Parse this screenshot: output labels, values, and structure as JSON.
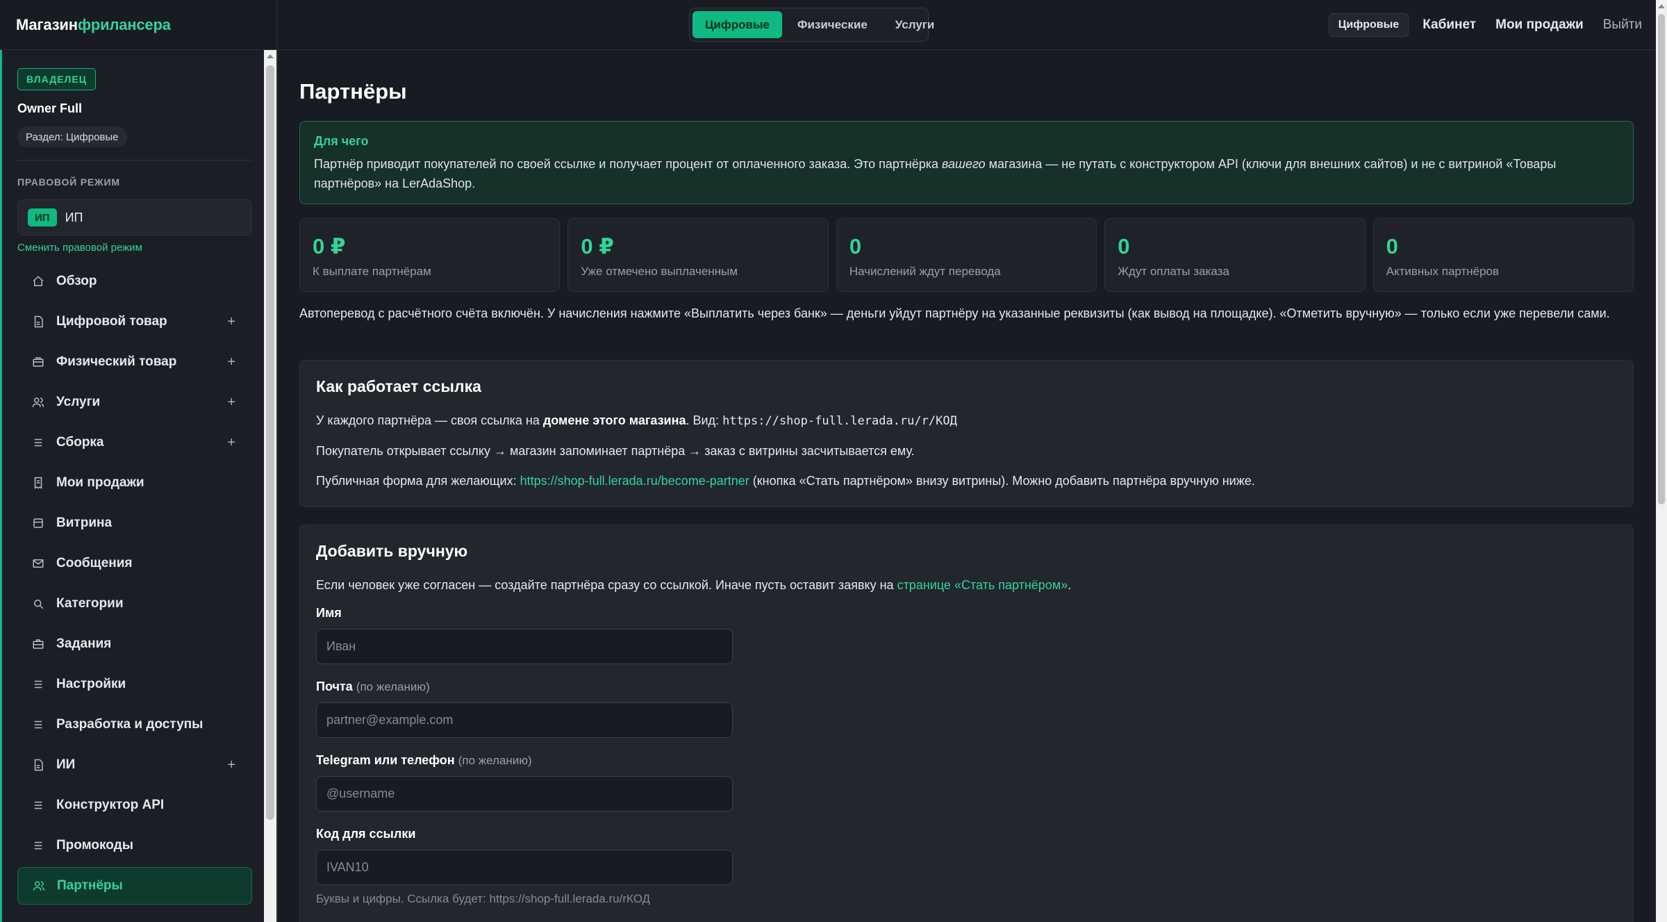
{
  "brand": {
    "part1": "Магазин",
    "part2": "фрилансера"
  },
  "header": {
    "segments": [
      {
        "label": "Цифровые",
        "active": true
      },
      {
        "label": "Физические",
        "active": false
      },
      {
        "label": "Услуги",
        "active": false
      }
    ],
    "mode_pill": "Цифровые",
    "nav": {
      "cabinet": "Кабинет",
      "my_sales": "Мои продажи",
      "logout": "Выйти"
    }
  },
  "sidebar": {
    "role_badge": "ВЛАДЕЛЕЦ",
    "owner_name": "Owner Full",
    "section_pill": "Раздел: Цифровые",
    "legal_title": "ПРАВОВОЙ РЕЖИМ",
    "legal_tag": "ИП",
    "legal_value": "ИП",
    "change_legal": "Сменить правовой режим",
    "items": [
      {
        "label": "Обзор",
        "icon": "home-icon",
        "expandable": false,
        "active": false
      },
      {
        "label": "Цифровой товар",
        "icon": "file-icon",
        "expandable": true,
        "active": false
      },
      {
        "label": "Физический товар",
        "icon": "box-icon",
        "expandable": true,
        "active": false
      },
      {
        "label": "Услуги",
        "icon": "users-icon",
        "expandable": true,
        "active": false
      },
      {
        "label": "Сборка",
        "icon": "list-icon",
        "expandable": true,
        "active": false
      },
      {
        "label": "Мои продажи",
        "icon": "receipt-icon",
        "expandable": false,
        "active": false
      },
      {
        "label": "Витрина",
        "icon": "store-icon",
        "expandable": false,
        "active": false
      },
      {
        "label": "Сообщения",
        "icon": "mail-icon",
        "expandable": false,
        "active": false
      },
      {
        "label": "Категории",
        "icon": "search-icon",
        "expandable": false,
        "active": false
      },
      {
        "label": "Задания",
        "icon": "briefcase-icon",
        "expandable": false,
        "active": false
      },
      {
        "label": "Настройки",
        "icon": "list-icon",
        "expandable": false,
        "active": false
      },
      {
        "label": "Разработка и доступы",
        "icon": "list-icon",
        "expandable": false,
        "active": false
      },
      {
        "label": "ИИ",
        "icon": "file-icon",
        "expandable": true,
        "active": false
      },
      {
        "label": "Конструктор API",
        "icon": "list-icon",
        "expandable": false,
        "active": false
      },
      {
        "label": "Промокоды",
        "icon": "list-icon",
        "expandable": false,
        "active": false
      },
      {
        "label": "Партнёры",
        "icon": "users-icon",
        "expandable": false,
        "active": true
      }
    ],
    "plus_symbol": "+"
  },
  "main": {
    "title": "Партнёры",
    "info": {
      "title": "Для чего",
      "text_before": "Партнёр приводит покупателей по своей ссылке и получает процент от оплаченного заказа. Это партнёрка ",
      "text_italic": "вашего",
      "text_after": " магазина — не путать с конструктором API (ключи для внешних сайтов) и не с витриной «Товары партнёров» на LerAdaShop."
    },
    "stats": [
      {
        "value": "0 ₽",
        "label": "К выплате партнёрам"
      },
      {
        "value": "0 ₽",
        "label": "Уже отмечено выплаченным"
      },
      {
        "value": "0",
        "label": "Начислений ждут перевода"
      },
      {
        "value": "0",
        "label": "Ждут оплаты заказа"
      },
      {
        "value": "0",
        "label": "Активных партнёров"
      }
    ],
    "auto_text": "Автоперевод с расчётного счёта включён. У начисления нажмите «Выплатить через банк» — деньги уйдут партнёру на указанные реквизиты (как вывод на площадке). «Отметить вручную» — только если уже перевели сами.",
    "how": {
      "title": "Как работает ссылка",
      "p1_before": "У каждого партнёра — своя ссылка на ",
      "p1_bold": "домене этого магазина",
      "p1_mid": ". Вид: ",
      "p1_code": "https://shop-full.lerada.ru/r/КОД",
      "p2": "Покупатель открывает ссылку → магазин запоминает партнёра → заказ с витрины засчитывается ему.",
      "p3_before": "Публичная форма для желающих: ",
      "p3_link": "https://shop-full.lerada.ru/become-partner",
      "p3_after": " (кнопка «Стать партнёром» внизу витрины). Можно добавить партнёра вручную ниже."
    },
    "add": {
      "title": "Добавить вручную",
      "intro_before": "Если человек уже согласен — создайте партнёра сразу со ссылкой. Иначе пусть оставит заявку на ",
      "intro_link": "странице «Стать партнёром»",
      "intro_after": ".",
      "name_label": "Имя",
      "name_placeholder": "Иван",
      "email_label": "Почта",
      "email_optional": "(по желанию)",
      "email_placeholder": "partner@example.com",
      "tg_label": "Telegram или телефон",
      "tg_optional": "(по желанию)",
      "tg_placeholder": "@username",
      "code_label": "Код для ссылки",
      "code_placeholder": "IVAN10",
      "code_hint": "Буквы и цифры. Ссылка будет: https://shop-full.lerada.ru/rКОД"
    }
  }
}
